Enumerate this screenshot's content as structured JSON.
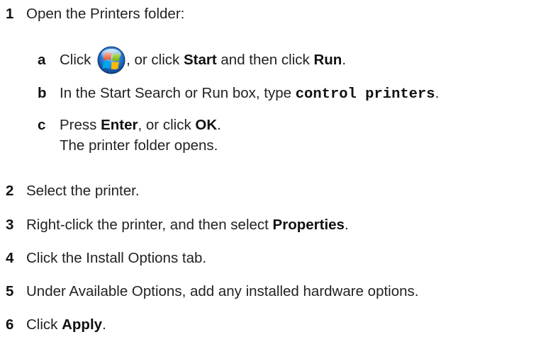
{
  "steps": [
    {
      "num": "1",
      "text": "Open the Printers folder:"
    },
    {
      "num": "2",
      "text": "Select the printer."
    },
    {
      "num": "3",
      "text_before": "Right-click the printer, and then select ",
      "bold": "Properties",
      "text_after": "."
    },
    {
      "num": "4",
      "text": "Click the Install Options tab."
    },
    {
      "num": "5",
      "text": "Under Available Options, add any installed hardware options."
    },
    {
      "num": "6",
      "text_before": "Click ",
      "bold": "Apply",
      "text_after": "."
    }
  ],
  "substeps": {
    "a": {
      "letter": "a",
      "text1": "Click ",
      "icon": "windows-start-orb-icon",
      "text2": ", or click ",
      "bold1": "Start",
      "text3": " and then click ",
      "bold2": "Run",
      "text4": "."
    },
    "b": {
      "letter": "b",
      "text1": "In the Start Search or Run box, type ",
      "code": "control printers",
      "text2": "."
    },
    "c": {
      "letter": "c",
      "text1": "Press ",
      "bold1": "Enter",
      "text2": ", or click ",
      "bold2": "OK",
      "text3": ".",
      "result": "The printer folder opens."
    }
  }
}
